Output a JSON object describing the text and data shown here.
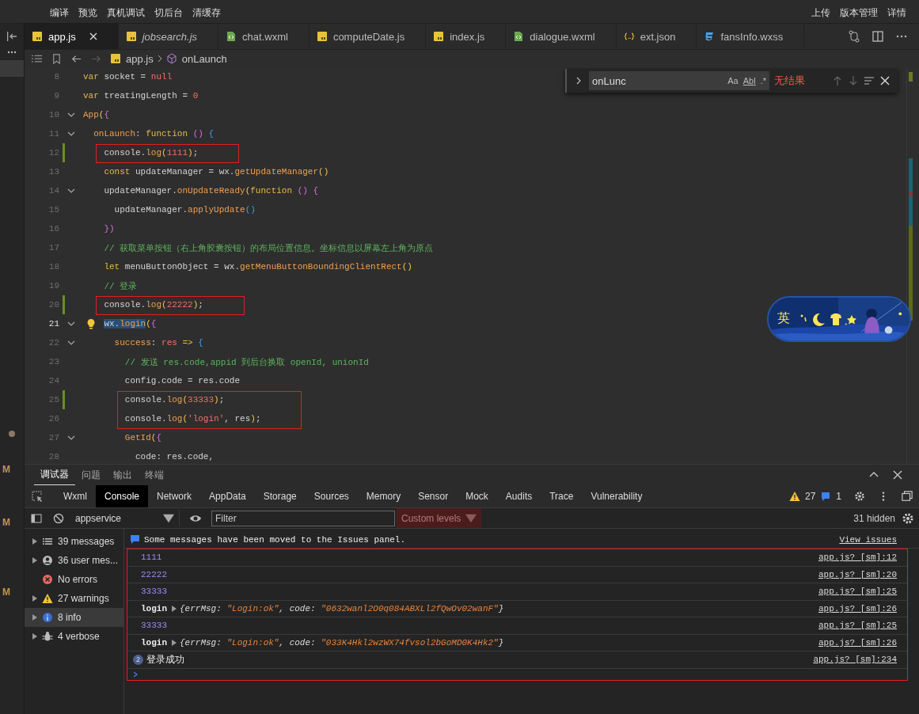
{
  "toolbar": {
    "left": [
      "编译",
      "预览",
      "真机调试",
      "切后台",
      "清缓存"
    ],
    "right": [
      "上传",
      "版本管理",
      "详情"
    ]
  },
  "explorer_strip": {
    "letters": [
      "M",
      "M",
      "M"
    ]
  },
  "tabs": [
    {
      "label": "app.js",
      "kind": "js",
      "selected": true,
      "preview": false
    },
    {
      "label": "jobsearch.js",
      "kind": "js",
      "selected": false,
      "preview": true
    },
    {
      "label": "chat.wxml",
      "kind": "wxml",
      "selected": false,
      "preview": false
    },
    {
      "label": "computeDate.js",
      "kind": "js",
      "selected": false,
      "preview": false
    },
    {
      "label": "index.js",
      "kind": "js",
      "selected": false,
      "preview": false
    },
    {
      "label": "dialogue.wxml",
      "kind": "wxml",
      "selected": false,
      "preview": false
    },
    {
      "label": "ext.json",
      "kind": "json",
      "selected": false,
      "preview": false
    },
    {
      "label": "fansInfo.wxss",
      "kind": "wxss",
      "selected": false,
      "preview": false
    }
  ],
  "breadcrumb": {
    "file": "app.js",
    "symbol": "onLaunch"
  },
  "find": {
    "value": "onLunc",
    "options": [
      "Aa",
      "Abl",
      ".*"
    ],
    "result": "无结果"
  },
  "code": [
    {
      "num": "8",
      "current": false,
      "modified": false,
      "foldable": false,
      "boxed": false,
      "tokens": [
        {
          "t": "var",
          "kind": "kw"
        },
        {
          "t": " socket = ",
          "kind": "plain"
        },
        {
          "t": "null",
          "kind": "num"
        }
      ]
    },
    {
      "num": "9",
      "current": false,
      "modified": false,
      "foldable": false,
      "boxed": false,
      "tokens": [
        {
          "t": "var",
          "kind": "kw"
        },
        {
          "t": " treatingLength = ",
          "kind": "plain"
        },
        {
          "t": "0",
          "kind": "num"
        }
      ]
    },
    {
      "num": "10",
      "current": false,
      "modified": false,
      "foldable": true,
      "boxed": false,
      "tokens": [
        {
          "t": "App",
          "kind": "fn"
        },
        {
          "t": "(",
          "kind": "b1"
        },
        {
          "t": "{",
          "kind": "b2"
        }
      ]
    },
    {
      "num": "11",
      "current": false,
      "modified": false,
      "foldable": true,
      "boxed": false,
      "tokens": [
        {
          "t": "  onLaunch",
          "kind": "fn"
        },
        {
          "t": ": ",
          "kind": "plain"
        },
        {
          "t": "function",
          "kind": "kw"
        },
        {
          "t": " ()",
          "kind": "b2"
        },
        {
          "t": " {",
          "kind": "b3"
        }
      ]
    },
    {
      "num": "12",
      "current": false,
      "modified": true,
      "foldable": false,
      "boxed": true,
      "tokens": [
        {
          "t": "    console.",
          "kind": "plain"
        },
        {
          "t": "log",
          "kind": "fn"
        },
        {
          "t": "(",
          "kind": "b1"
        },
        {
          "t": "1111",
          "kind": "num"
        },
        {
          "t": ")",
          "kind": "b1"
        },
        {
          "t": ";",
          "kind": "plain"
        }
      ]
    },
    {
      "num": "13",
      "current": false,
      "modified": false,
      "foldable": false,
      "boxed": false,
      "tokens": [
        {
          "t": "    const",
          "kind": "kw"
        },
        {
          "t": " updateManager = wx.",
          "kind": "plain"
        },
        {
          "t": "getUpdateManager",
          "kind": "fn"
        },
        {
          "t": "()",
          "kind": "b1"
        }
      ]
    },
    {
      "num": "14",
      "current": false,
      "modified": false,
      "foldable": true,
      "boxed": false,
      "tokens": [
        {
          "t": "    updateManager.",
          "kind": "plain"
        },
        {
          "t": "onUpdateReady",
          "kind": "fn"
        },
        {
          "t": "(",
          "kind": "b1"
        },
        {
          "t": "function",
          "kind": "kw"
        },
        {
          "t": " ()",
          "kind": "b2"
        },
        {
          "t": " {",
          "kind": "b2"
        }
      ]
    },
    {
      "num": "15",
      "current": false,
      "modified": false,
      "foldable": false,
      "boxed": false,
      "tokens": [
        {
          "t": "      updateManager.",
          "kind": "plain"
        },
        {
          "t": "applyUpdate",
          "kind": "fn"
        },
        {
          "t": "()",
          "kind": "b3"
        }
      ]
    },
    {
      "num": "16",
      "current": false,
      "modified": false,
      "foldable": false,
      "boxed": false,
      "tokens": [
        {
          "t": "    })",
          "kind": "b2"
        }
      ]
    },
    {
      "num": "17",
      "current": false,
      "modified": false,
      "foldable": false,
      "boxed": false,
      "tokens": [
        {
          "t": "    // 获取菜单按钮（右上角胶囊按钮）的布局位置信息。坐标信息以屏幕左上角为原点",
          "kind": "cmt"
        }
      ]
    },
    {
      "num": "18",
      "current": false,
      "modified": false,
      "foldable": false,
      "boxed": false,
      "tokens": [
        {
          "t": "    let",
          "kind": "kw"
        },
        {
          "t": " menuButtonObject = wx.",
          "kind": "plain"
        },
        {
          "t": "getMenuButtonBoundingClientRect",
          "kind": "fn"
        },
        {
          "t": "()",
          "kind": "b1"
        }
      ]
    },
    {
      "num": "19",
      "current": false,
      "modified": false,
      "foldable": false,
      "boxed": false,
      "tokens": [
        {
          "t": "    // 登录",
          "kind": "cmt"
        }
      ]
    },
    {
      "num": "20",
      "current": false,
      "modified": true,
      "foldable": false,
      "boxed": true,
      "tokens": [
        {
          "t": "    console.",
          "kind": "plain"
        },
        {
          "t": "log",
          "kind": "fn"
        },
        {
          "t": "(",
          "kind": "b1"
        },
        {
          "t": "22222",
          "kind": "num"
        },
        {
          "t": ")",
          "kind": "b1"
        },
        {
          "t": ";",
          "kind": "plain"
        }
      ]
    },
    {
      "num": "21",
      "current": true,
      "modified": false,
      "foldable": true,
      "boxed": false,
      "tokens": [
        {
          "t": "    wx.",
          "kind": "plain",
          "sel": true
        },
        {
          "t": "login",
          "kind": "fn",
          "sel": true
        },
        {
          "t": "(",
          "kind": "b1",
          "sel": false
        },
        {
          "t": "{",
          "kind": "b2",
          "sel": false
        }
      ]
    },
    {
      "num": "22",
      "current": false,
      "modified": false,
      "foldable": true,
      "boxed": false,
      "tokens": [
        {
          "t": "      success",
          "kind": "fn"
        },
        {
          "t": ": ",
          "kind": "plain"
        },
        {
          "t": "res",
          "kind": "num"
        },
        {
          "t": " =>",
          "kind": "kw"
        },
        {
          "t": " {",
          "kind": "b3"
        }
      ]
    },
    {
      "num": "23",
      "current": false,
      "modified": false,
      "foldable": false,
      "boxed": false,
      "tokens": [
        {
          "t": "        // 发送 res.code,appid 到后台换取 openId, unionId",
          "kind": "cmt"
        }
      ]
    },
    {
      "num": "24",
      "current": false,
      "modified": false,
      "foldable": false,
      "boxed": false,
      "tokens": [
        {
          "t": "        config.code = res.code",
          "kind": "plain"
        }
      ]
    },
    {
      "num": "25",
      "current": false,
      "modified": true,
      "foldable": false,
      "boxed": true,
      "tokens": [
        {
          "t": "        console.",
          "kind": "plain"
        },
        {
          "t": "log",
          "kind": "fn"
        },
        {
          "t": "(",
          "kind": "b1"
        },
        {
          "t": "33333",
          "kind": "num"
        },
        {
          "t": ")",
          "kind": "b1"
        },
        {
          "t": ";",
          "kind": "plain"
        }
      ]
    },
    {
      "num": "26",
      "current": false,
      "modified": false,
      "foldable": false,
      "boxed": true,
      "tokens": [
        {
          "t": "        console.",
          "kind": "plain"
        },
        {
          "t": "log",
          "kind": "fn"
        },
        {
          "t": "(",
          "kind": "b1"
        },
        {
          "t": "'login'",
          "kind": "str"
        },
        {
          "t": ", res",
          "kind": "plain"
        },
        {
          "t": ")",
          "kind": "b1"
        },
        {
          "t": ";",
          "kind": "plain"
        }
      ]
    },
    {
      "num": "27",
      "current": false,
      "modified": false,
      "foldable": true,
      "boxed": false,
      "tokens": [
        {
          "t": "        GetId",
          "kind": "fn"
        },
        {
          "t": "(",
          "kind": "b1"
        },
        {
          "t": "{",
          "kind": "b2"
        }
      ]
    },
    {
      "num": "28",
      "current": false,
      "modified": false,
      "foldable": false,
      "boxed": false,
      "tokens": [
        {
          "t": "          code: res.code,",
          "kind": "plain"
        }
      ]
    }
  ],
  "ime": {
    "mode": "英"
  },
  "panel": {
    "tabs": [
      {
        "label": "调试器",
        "selected": true
      },
      {
        "label": "问题",
        "selected": false
      },
      {
        "label": "输出",
        "selected": false
      },
      {
        "label": "终端",
        "selected": false
      }
    ]
  },
  "devtools": {
    "tabs": [
      {
        "label": "Wxml",
        "selected": false
      },
      {
        "label": "Console",
        "selected": true
      },
      {
        "label": "Network",
        "selected": false
      },
      {
        "label": "AppData",
        "selected": false
      },
      {
        "label": "Storage",
        "selected": false
      },
      {
        "label": "Sources",
        "selected": false
      },
      {
        "label": "Memory",
        "selected": false
      },
      {
        "label": "Sensor",
        "selected": false
      },
      {
        "label": "Mock",
        "selected": false
      },
      {
        "label": "Audits",
        "selected": false
      },
      {
        "label": "Trace",
        "selected": false
      },
      {
        "label": "Vulnerability",
        "selected": false
      }
    ],
    "warnings": "27",
    "issues": "1"
  },
  "console": {
    "context": "appservice",
    "filter_placeholder": "Filter",
    "levels": "Custom levels",
    "hidden": "31 hidden",
    "sidebar": [
      {
        "label": "39 messages",
        "kind": "list",
        "expandable": true,
        "selected": false
      },
      {
        "label": "36 user mes...",
        "kind": "user",
        "expandable": true,
        "selected": false
      },
      {
        "label": "No errors",
        "kind": "error",
        "expandable": false,
        "selected": false
      },
      {
        "label": "27 warnings",
        "kind": "warning",
        "expandable": true,
        "selected": false
      },
      {
        "label": "8 info",
        "kind": "info",
        "expandable": true,
        "selected": true
      },
      {
        "label": "4 verbose",
        "kind": "verbose",
        "expandable": true,
        "selected": false
      }
    ],
    "banner": {
      "text": "Some messages have been moved to the Issues panel.",
      "link": "View issues"
    },
    "entries_boxed": true,
    "entries": [
      {
        "kind": "number",
        "text": "1111",
        "source": "app.js? [sm]:12"
      },
      {
        "kind": "number",
        "text": "22222",
        "source": "app.js? [sm]:20"
      },
      {
        "kind": "number",
        "text": "33333",
        "source": "app.js? [sm]:25"
      },
      {
        "kind": "object",
        "label": "login",
        "parts": [
          {
            "t": "{errMsg: ",
            "kind": "key"
          },
          {
            "t": "\"Login:ok\"",
            "kind": "str"
          },
          {
            "t": ", code: ",
            "kind": "key"
          },
          {
            "t": "\"0632wanl2O0q084ABXLl2fQwOv02wanF\"",
            "kind": "str"
          },
          {
            "t": "}",
            "kind": "key"
          }
        ],
        "source": "app.js? [sm]:26"
      },
      {
        "kind": "number",
        "text": "33333",
        "source": "app.js? [sm]:25"
      },
      {
        "kind": "object",
        "label": "login",
        "parts": [
          {
            "t": "{errMsg: ",
            "kind": "key"
          },
          {
            "t": "\"Login:ok\"",
            "kind": "str"
          },
          {
            "t": ", code: ",
            "kind": "key"
          },
          {
            "t": "\"033K4Hkl2wzWX74fvsol2bGoMD0K4Hk2\"",
            "kind": "str"
          },
          {
            "t": "}",
            "kind": "key"
          }
        ],
        "source": "app.js? [sm]:26"
      },
      {
        "kind": "group",
        "count": "2",
        "text": "登录成功",
        "source": "app.js? [sm]:234"
      }
    ]
  }
}
